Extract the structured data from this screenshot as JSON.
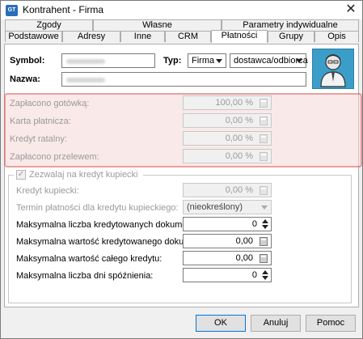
{
  "window": {
    "title": "Kontrahent - Firma",
    "icon_text": "GT"
  },
  "tabs_row1": [
    "Zgody",
    "Własne",
    "Parametry indywidualne"
  ],
  "tabs_row2": [
    "Podstawowe",
    "Adresy",
    "Inne",
    "CRM",
    "Płatności",
    "Grupy",
    "Opis"
  ],
  "active_tab": "Płatności",
  "form": {
    "symbol_label": "Symbol:",
    "typ_label": "Typ:",
    "typ_value": "Firma",
    "role_value": "dostawca/odbiorca",
    "nazwa_label": "Nazwa:"
  },
  "payments": [
    {
      "label": "Zapłacono gotówką:",
      "value": "100,00 %"
    },
    {
      "label": "Karta płatnicza:",
      "value": "0,00 %"
    },
    {
      "label": "Kredyt ratalny:",
      "value": "0,00 %"
    },
    {
      "label": "Zapłacono przelewem:",
      "value": "0,00 %"
    }
  ],
  "credit": {
    "checkbox_label": "Zezwalaj na kredyt kupiecki",
    "checked": true,
    "kredyt_label": "Kredyt kupiecki:",
    "kredyt_value": "0,00 %",
    "termin_label": "Termin płatności dla kredytu kupieckiego:",
    "termin_value": "(nieokreślony)",
    "max_docs_label": "Maksymalna liczba kredytowanych dokumentów:",
    "max_docs_value": "0",
    "max_doc_value_label": "Maksymalna wartość kredytowanego dokumentu:",
    "max_doc_value": "0,00",
    "max_total_label": "Maksymalna wartość całego kredytu:",
    "max_total_value": "0,00",
    "max_days_label": "Maksymalna liczba dni spóźnienia:",
    "max_days_value": "0"
  },
  "buttons": {
    "ok": "OK",
    "cancel": "Anuluj",
    "help": "Pomoc"
  },
  "colors": {
    "accent": "#0078d7",
    "highlight": "#d9534f"
  }
}
